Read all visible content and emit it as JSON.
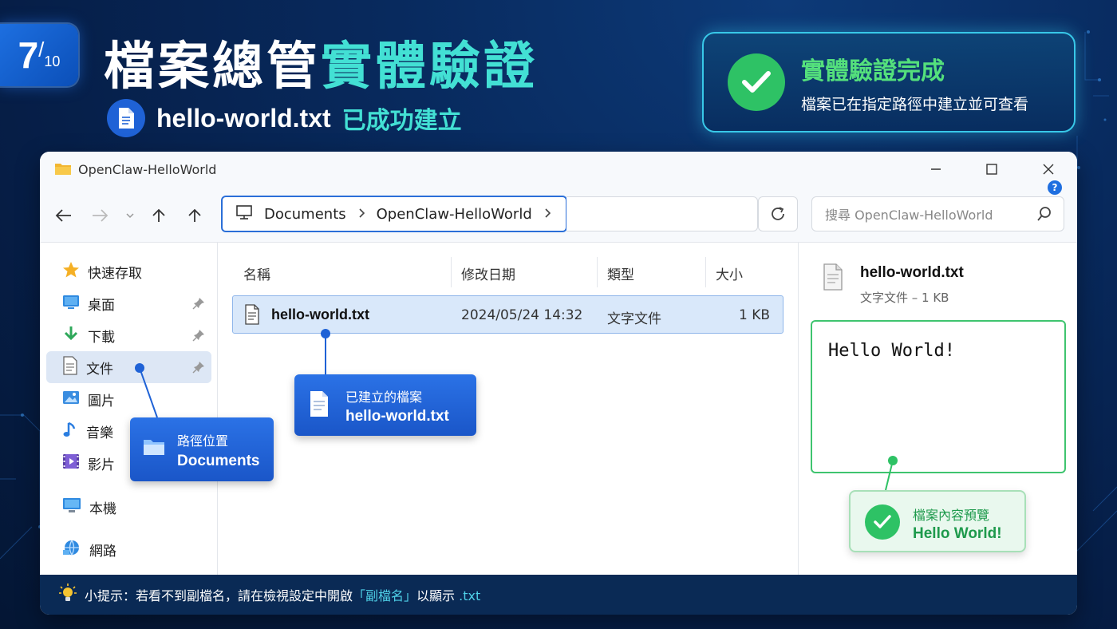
{
  "slide": {
    "current": "7",
    "total": "10"
  },
  "header": {
    "title_main": "檔案總管",
    "title_accent": "實體驗證",
    "subtitle_file": "hello-world.txt",
    "subtitle_status": "已成功建立"
  },
  "verify_card": {
    "title": "實體驗證完成",
    "subtitle": "檔案已在指定路徑中建立並可查看"
  },
  "window": {
    "title": "OpenClaw-HelloWorld",
    "breadcrumb": [
      "Documents",
      "OpenClaw-HelloWorld"
    ],
    "search_placeholder": "搜尋 OpenClaw-HelloWorld",
    "help_label": "?"
  },
  "sidebar": {
    "items": [
      {
        "label": "快速存取",
        "icon": "star-icon"
      },
      {
        "label": "桌面",
        "icon": "desktop-icon",
        "pinned": true
      },
      {
        "label": "下載",
        "icon": "download-icon",
        "pinned": true
      },
      {
        "label": "文件",
        "icon": "document-icon",
        "pinned": true,
        "active": true
      },
      {
        "label": "圖片",
        "icon": "pictures-icon"
      },
      {
        "label": "音樂",
        "icon": "music-icon"
      },
      {
        "label": "影片",
        "icon": "video-icon"
      },
      {
        "label": "本機",
        "icon": "computer-icon"
      },
      {
        "label": "網路",
        "icon": "network-icon"
      }
    ]
  },
  "file_list": {
    "columns": [
      "名稱",
      "修改日期",
      "類型",
      "大小"
    ],
    "rows": [
      {
        "name": "hello-world.txt",
        "modified": "2024/05/24  14:32",
        "type": "文字文件",
        "size": "1 KB"
      }
    ]
  },
  "preview": {
    "name": "hello-world.txt",
    "meta": "文字文件 – 1 KB",
    "content": "Hello World!"
  },
  "callouts": {
    "path": {
      "line1": "路徑位置",
      "line2": "Documents"
    },
    "file": {
      "line1": "已建立的檔案",
      "line2": "hello-world.txt"
    },
    "preview": {
      "line1": "檔案內容預覽",
      "line2": "Hello World!"
    }
  },
  "hint": {
    "prefix": "小提示：若看不到副檔名，請在檢視設定中開啟",
    "highlight": "「副檔名」",
    "mid": "以顯示",
    "ext": ".txt"
  },
  "colors": {
    "accent_cyan": "#43e0d4",
    "success_green": "#2ec265",
    "primary_blue": "#1f62d6",
    "bg_navy": "#061e47"
  }
}
